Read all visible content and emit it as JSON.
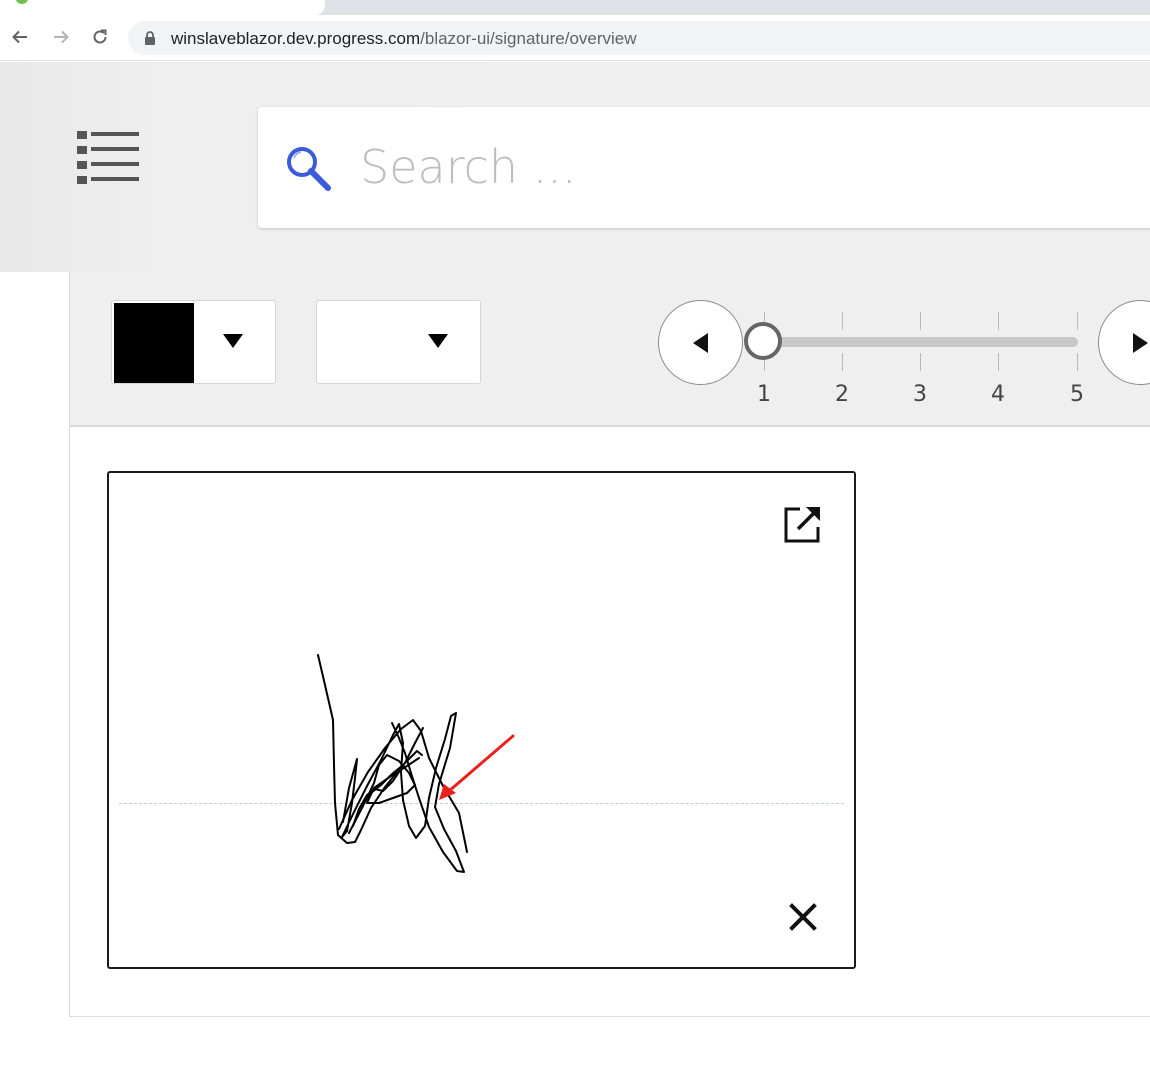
{
  "browser": {
    "url_domain": "winslaveblazor.dev.progress.com",
    "url_path": "/blazor-ui/signature/overview",
    "icons": {
      "back": "back-arrow-icon",
      "forward": "forward-arrow-icon",
      "reload": "reload-icon",
      "lock": "lock-icon"
    }
  },
  "header": {
    "menu_icon": "list-menu-icon",
    "search": {
      "placeholder": "Search ...",
      "value": "",
      "icon": "search-icon",
      "icon_color": "#3b5bdb"
    }
  },
  "config": {
    "stroke_color": {
      "value": "#000000",
      "icon": "chevron-down-icon"
    },
    "background_color": {
      "value": "",
      "icon": "chevron-down-icon"
    },
    "stroke_width_slider": {
      "min": 1,
      "max": 5,
      "value": 1,
      "ticks": [
        "1",
        "2",
        "3",
        "4",
        "5"
      ],
      "decrease_icon": "caret-left-icon",
      "increase_icon": "caret-right-icon"
    }
  },
  "signature": {
    "maximize_icon": "external-link-icon",
    "clear_icon": "close-icon",
    "stroke_color": "#000000",
    "annotation_arrow_color": "#e8211d"
  }
}
